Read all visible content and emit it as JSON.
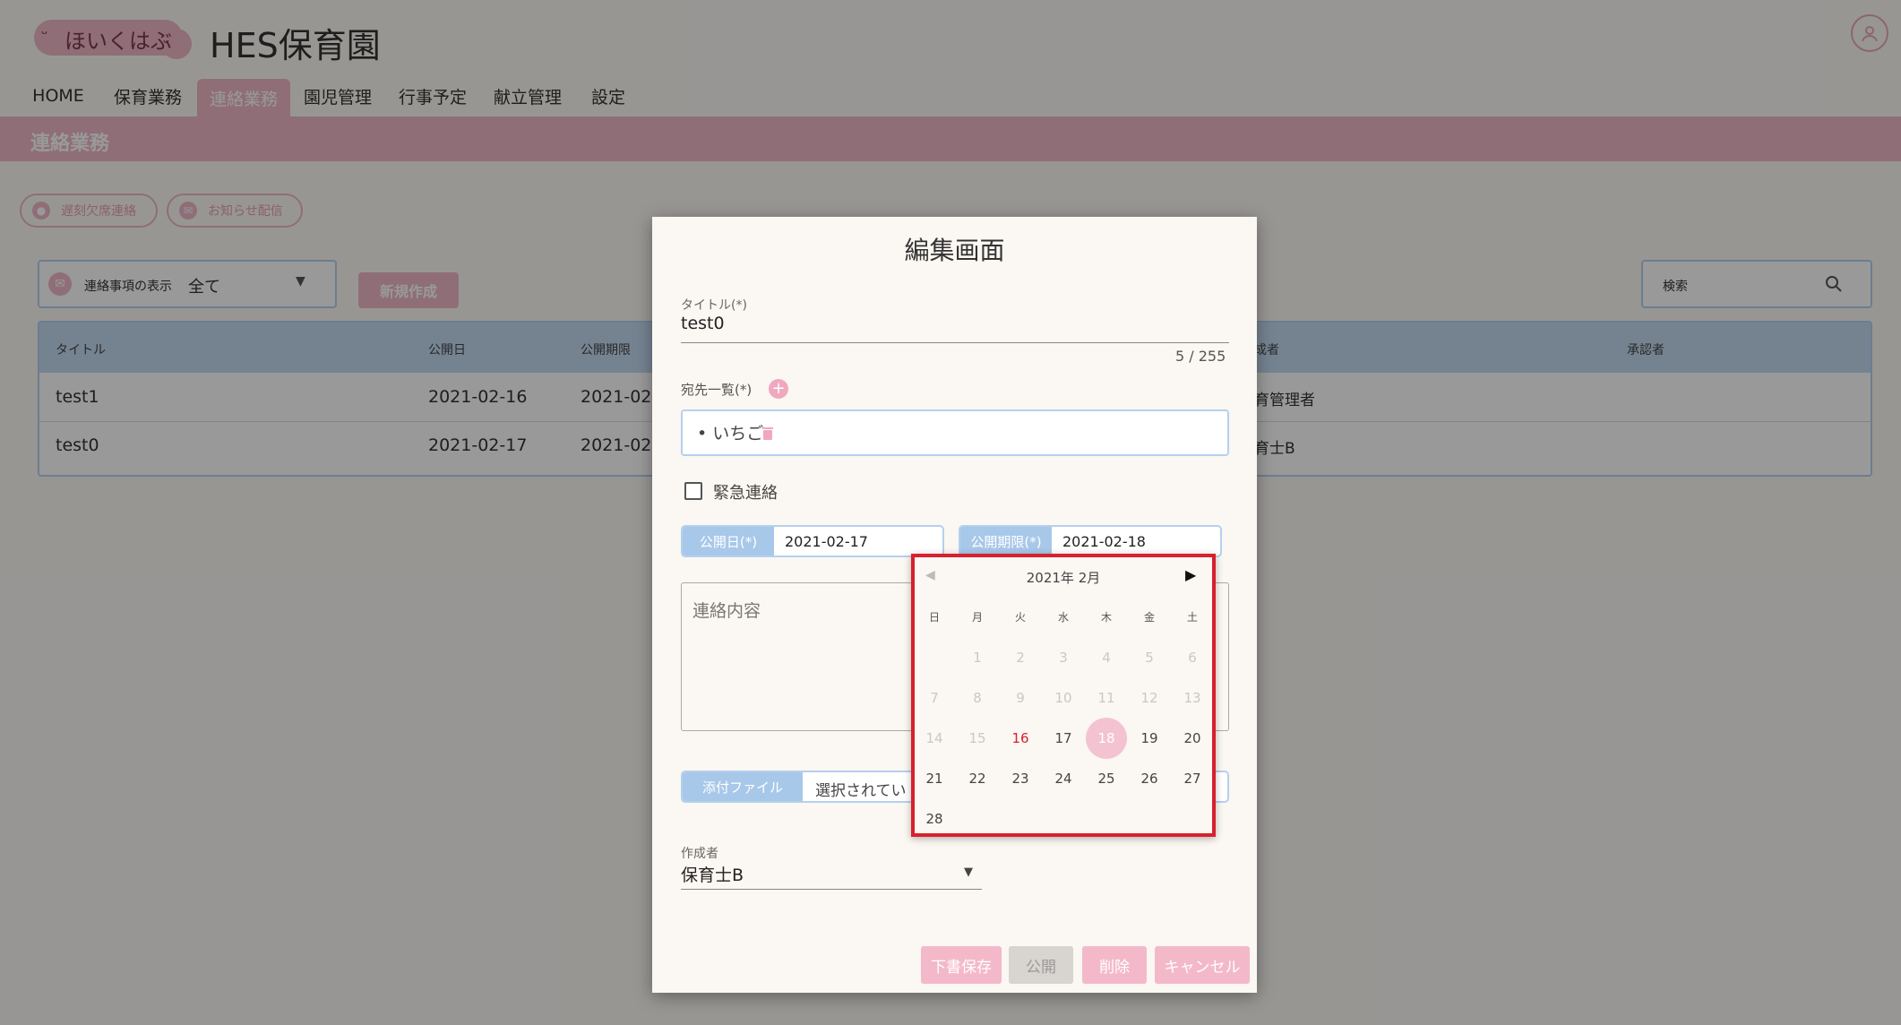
{
  "header": {
    "logo_text": "ほいくはぶ",
    "brand": "HES保育園"
  },
  "nav": [
    "HOME",
    "保育業務",
    "連絡業務",
    "園児管理",
    "行事予定",
    "献立管理",
    "設定"
  ],
  "nav_active_index": 2,
  "banner": {
    "title": "連絡業務"
  },
  "actions": {
    "absence_label": "遅刻欠席連絡",
    "notice_label": "お知らせ配信"
  },
  "filter": {
    "label": "連絡事項の表示",
    "value": "全て",
    "new_label": "新規作成"
  },
  "search": {
    "placeholder": "検索"
  },
  "table": {
    "headers": [
      "タイトル",
      "公開日",
      "公開期限",
      "成者",
      "承認者"
    ],
    "rows": [
      {
        "title": "test1",
        "date": "2021-02-16",
        "expiry": "2021-02-",
        "author": "育管理者"
      },
      {
        "title": "test0",
        "date": "2021-02-17",
        "expiry": "2021-02-",
        "author": "育士B"
      }
    ]
  },
  "dialog": {
    "title": "編集画面",
    "title_label": "タイトル(*)",
    "title_value": "test0",
    "counter": "5 / 255",
    "dest_label": "宛先一覧(*)",
    "dest_item": "• いちご",
    "urgent_label": "緊急連絡",
    "pub_label": "公開日(*)",
    "pub_value": "2021-02-17",
    "exp_label": "公開期限(*)",
    "exp_value": "2021-02-18",
    "content_placeholder": "連絡内容",
    "attach_label": "添付ファイル",
    "attach_value": "選択されてい",
    "author_label": "作成者",
    "author_value": "保育士B",
    "buttons": {
      "draft": "下書保存",
      "publish": "公開",
      "delete": "削除",
      "cancel": "キャンセル"
    }
  },
  "calendar": {
    "month_label": "2021年 2月",
    "weekdays": [
      "日",
      "月",
      "火",
      "水",
      "木",
      "金",
      "土"
    ],
    "days": [
      [
        "",
        "1",
        "2",
        "3",
        "4",
        "5",
        "6"
      ],
      [
        "7",
        "8",
        "9",
        "10",
        "11",
        "12",
        "13"
      ],
      [
        "14",
        "15",
        "16",
        "17",
        "18",
        "19",
        "20"
      ],
      [
        "21",
        "22",
        "23",
        "24",
        "25",
        "26",
        "27"
      ],
      [
        "28",
        "",
        "",
        "",
        "",
        "",
        ""
      ]
    ],
    "today": "16",
    "selected": "18",
    "first_enabled": "16"
  },
  "colors": {
    "accent_pink": "#eeb8c8",
    "accent_blue": "#a8c8ea",
    "highlight_red": "#d8202e"
  }
}
